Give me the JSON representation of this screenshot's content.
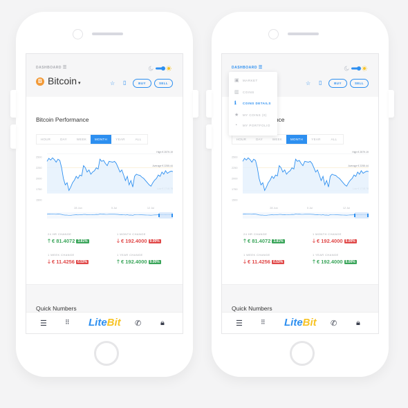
{
  "header": {
    "breadcrumb": "DASHBOARD",
    "coin_name": "Bitcoin",
    "coin_symbol": "B",
    "buy": "BUY",
    "sell": "SELL"
  },
  "performance": {
    "title": "Bitcoin Performance",
    "tabs": [
      "HOUR",
      "DAY",
      "WEEK",
      "MONTH",
      "YEAR",
      "ALL"
    ],
    "active_tab": "MONTH"
  },
  "chart_data": {
    "type": "area",
    "yticks": [
      "2500",
      "2250",
      "2000",
      "1750",
      "1500"
    ],
    "ylim": [
      1500,
      2550
    ],
    "xticks": [
      "28 Jun",
      "5 Jul",
      "12 Jul"
    ],
    "high_label": "High € 2579.19",
    "average_label": "Average € 2255.44",
    "low_label": "Low € 1718.78",
    "values": [
      2400,
      2470,
      2430,
      2480,
      2440,
      2380,
      2450,
      2420,
      2250,
      2000,
      1850,
      1900,
      1720,
      1800,
      1900,
      1960,
      2050,
      2000,
      2080,
      2060,
      2300,
      2250,
      2150,
      2200,
      2100,
      2150,
      2180,
      2250,
      2220,
      2450,
      2400,
      2420,
      2350,
      2300,
      2400,
      2390,
      2380,
      2400,
      2350,
      2250,
      2150,
      2200,
      2080,
      1950,
      2050,
      1850,
      1950,
      1800,
      2050,
      2100,
      2080,
      2070,
      2030,
      2000,
      1950,
      1900,
      1850,
      1820,
      1900,
      1960,
      2000,
      2080,
      2050,
      2150,
      2100,
      2180,
      2120,
      2150,
      2170,
      2160
    ],
    "color": "#2d8ff0"
  },
  "stats": [
    {
      "label": "24 HR CHANGE",
      "value": "€ 81.4072",
      "badge": "3.81%",
      "dir": "up"
    },
    {
      "label": "1 MONTH CHANGE",
      "value": "€ 192.4000",
      "badge": "9.00%",
      "dir": "down"
    },
    {
      "label": "1 WEEK CHANGE",
      "value": "€ 11.4256",
      "badge": "0.53%",
      "dir": "down"
    },
    {
      "label": "1 YEAR CHANGE",
      "value": "€ 192.4000",
      "badge": "9.00%",
      "dir": "up"
    }
  ],
  "quick_numbers": "Quick Numbers",
  "logo": {
    "part1": "Lite",
    "part2": "Bit"
  },
  "menu": {
    "items": [
      {
        "label": "MARKET",
        "icon": "market-icon",
        "active": false
      },
      {
        "label": "COINS",
        "icon": "coins-icon",
        "active": false
      },
      {
        "label": "COINS DETAILS",
        "icon": "info-icon",
        "active": true
      },
      {
        "label": "MY COINS (0)",
        "icon": "star-icon",
        "active": false
      },
      {
        "label": "MY PORTFOLIO",
        "icon": "portfolio-icon",
        "active": false
      }
    ]
  },
  "colors": {
    "accent": "#2d8ff0",
    "up": "#3aa55a",
    "down": "#e04848",
    "bitcoin": "#f29a38",
    "logo_yellow": "#f7c325"
  }
}
